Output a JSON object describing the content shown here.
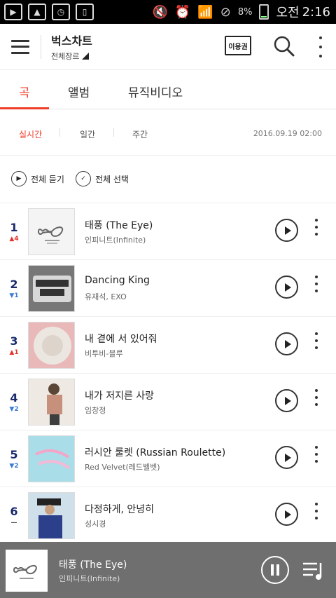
{
  "status_bar": {
    "battery": "8%",
    "ampm": "오전",
    "time": "2:16"
  },
  "app_bar": {
    "title": "벅스차트",
    "genre": "전체장르",
    "ticket_label": "이용권"
  },
  "tabs": [
    {
      "label": "곡",
      "active": true
    },
    {
      "label": "앨범",
      "active": false
    },
    {
      "label": "뮤직비디오",
      "active": false
    }
  ],
  "period": {
    "options": [
      "실시간",
      "일간",
      "주간"
    ],
    "selected": "실시간",
    "date": "2016.09.19 02:00"
  },
  "actions": {
    "play_all": "전체 듣기",
    "select_all": "전체 선택"
  },
  "songs": [
    {
      "rank": "1",
      "change": "4",
      "direction": "up",
      "title": "태풍 (The Eye)",
      "artist": "인피니트(Infinite)"
    },
    {
      "rank": "2",
      "change": "1",
      "direction": "down",
      "title": "Dancing King",
      "artist": "유재석, EXO"
    },
    {
      "rank": "3",
      "change": "1",
      "direction": "up",
      "title": "내 곁에 서 있어줘",
      "artist": "비투비-블루"
    },
    {
      "rank": "4",
      "change": "2",
      "direction": "down",
      "title": "내가 저지른 사랑",
      "artist": "임창정"
    },
    {
      "rank": "5",
      "change": "2",
      "direction": "down",
      "title": "러시안 룰렛 (Russian Roulette)",
      "artist": "Red Velvet(레드벨벳)"
    },
    {
      "rank": "6",
      "change": "—",
      "direction": "same",
      "title": "다정하게, 안녕히",
      "artist": "성시경"
    }
  ],
  "mini_player": {
    "title": "태풍 (The Eye)",
    "artist": "인피니트(Infinite)"
  },
  "colors": {
    "accent": "#f03c28",
    "rank": "#1a2a6c",
    "up": "#e3322b",
    "down": "#3a7bd5",
    "player_bg": "#6f6f6f"
  }
}
